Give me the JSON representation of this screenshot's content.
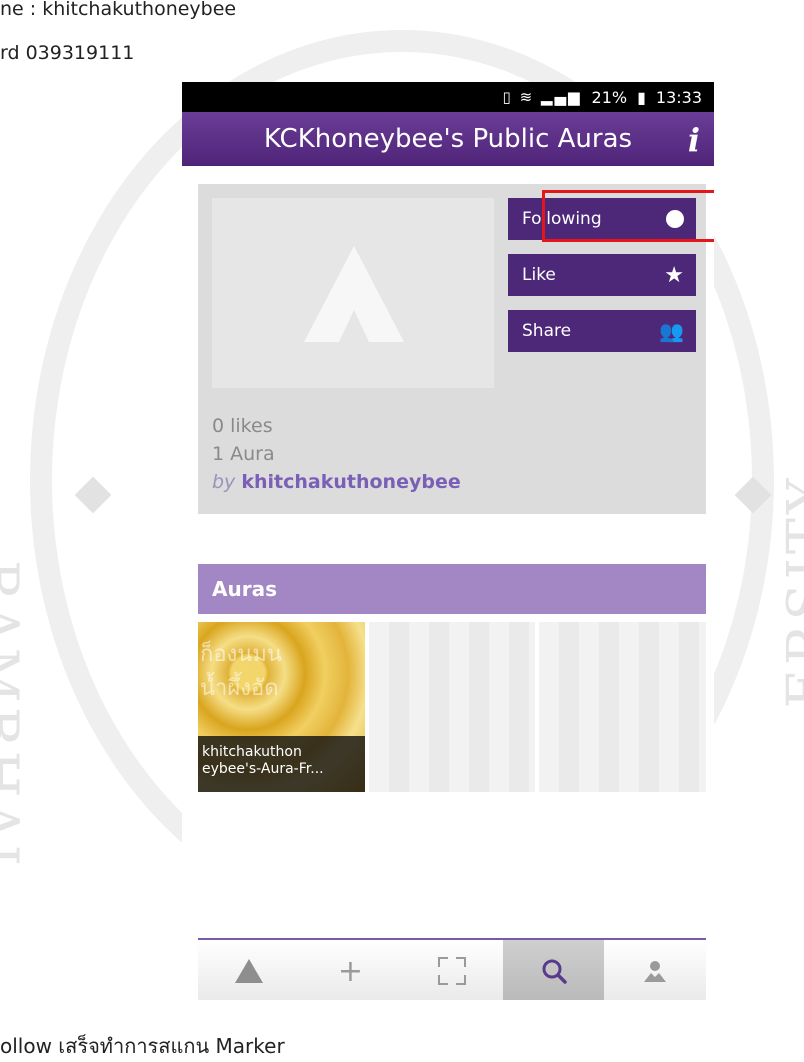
{
  "document": {
    "line1": "ne : khitchakuthoneybee",
    "line2": "rd 039319111",
    "caption": "ollow เสร็จทำการสแกน Marker",
    "watermark_left": "RAMBHAI",
    "watermark_right": "ERSITY"
  },
  "status_bar": {
    "battery_percent": "21%",
    "time": "13:33",
    "icons": [
      "vibrate-icon",
      "wifi-icon",
      "signal-icon",
      "battery-icon"
    ]
  },
  "app": {
    "title": "KCKhoneybee's Public Auras",
    "info_icon": "i"
  },
  "profile": {
    "buttons": {
      "following": "Following",
      "like": "Like",
      "share": "Share"
    },
    "likes": "0 likes",
    "aura_count": "1 Aura",
    "by_prefix": "by",
    "owner": "khitchakuthoneybee"
  },
  "auras": {
    "header": "Auras",
    "tiles": [
      {
        "caption": "khitchakuthon eybee's-Aura-Fr...",
        "overlay": "ก็องนมน\nน้ำผึ้งอัด"
      }
    ]
  },
  "bottom_nav": {
    "items": [
      "home-logo-icon",
      "add-icon",
      "scan-icon",
      "search-icon",
      "profile-icon"
    ],
    "active": "search-icon"
  },
  "colors": {
    "header_purple": "#5a2e86",
    "button_purple": "#4e2878",
    "auras_header": "#a287c4",
    "highlight_red": "#e4161b"
  }
}
